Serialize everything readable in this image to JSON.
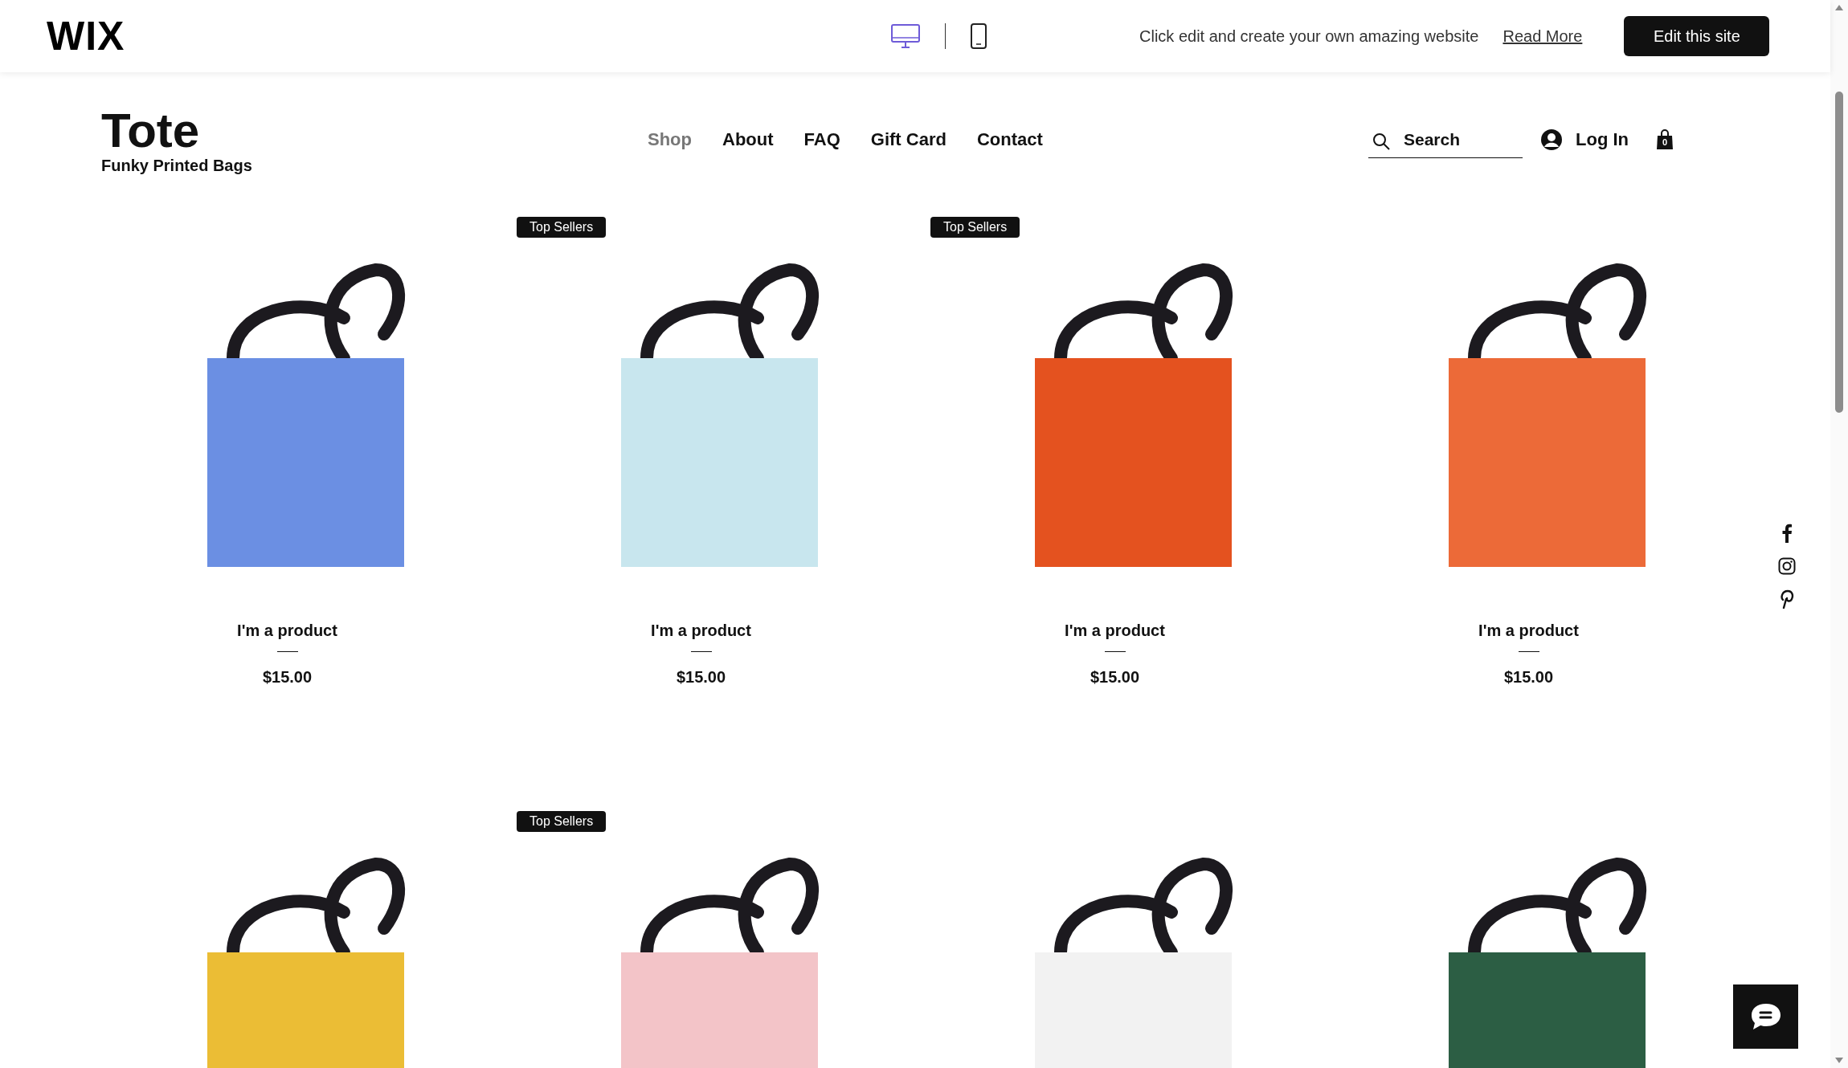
{
  "editor_bar": {
    "logo": "WIX",
    "promo": "Click edit and create your own amazing website",
    "read_more": "Read More",
    "edit_button": "Edit this site",
    "devices": [
      {
        "kind": "desktop",
        "selected": true
      },
      {
        "kind": "mobile",
        "selected": false
      }
    ]
  },
  "site": {
    "title": "Tote",
    "tagline": "Funky Printed Bags"
  },
  "nav": [
    {
      "label": "Shop",
      "selected": true
    },
    {
      "label": "About",
      "selected": false
    },
    {
      "label": "FAQ",
      "selected": false
    },
    {
      "label": "Gift Card",
      "selected": false
    },
    {
      "label": "Contact",
      "selected": false
    }
  ],
  "search": {
    "placeholder": "Search"
  },
  "login": "Log In",
  "cart": {
    "count": "0"
  },
  "products": [
    {
      "color": "#6b8fe3",
      "title": "I'm a product",
      "price": "$15.00"
    },
    {
      "badge": "Top Sellers",
      "color": "#c8e6ee",
      "title": "I'm a product",
      "price": "$15.00"
    },
    {
      "badge": "Top Sellers",
      "color": "#e4521f",
      "title": "I'm a product",
      "price": "$15.00"
    },
    {
      "color": "#ec6a38",
      "title": "I'm a product",
      "price": "$15.00"
    },
    {
      "color": "#ebbd35"
    },
    {
      "badge": "Top Sellers",
      "color": "#f3c4c8"
    },
    {
      "color": "#f2f2f2"
    },
    {
      "color": "#2c5e44"
    }
  ]
}
